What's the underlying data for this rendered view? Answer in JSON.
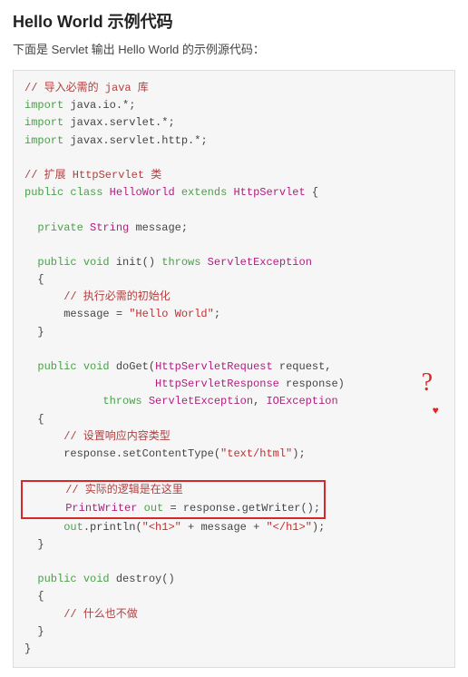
{
  "header": {
    "title": "Hello World 示例代码",
    "subtitle": "下面是 Servlet 输出 Hello World 的示例源代码："
  },
  "code": {
    "c1": "// 导入必需的 java 库",
    "l2a": "import",
    "l2b": " java.io.*;",
    "l3a": "import",
    "l3b": " javax.servlet.*;",
    "l4a": "import",
    "l4b": " javax.servlet.http.*;",
    "c5": "// 扩展 HttpServlet 类",
    "l6a": "public",
    "l6b": " ",
    "l6c": "class",
    "l6d": " ",
    "l6e": "HelloWorld",
    "l6f": " ",
    "l6g": "extends",
    "l6h": " ",
    "l6i": "HttpServlet",
    "l6j": " {",
    "l8a": "  ",
    "l8b": "private",
    "l8c": " ",
    "l8d": "String",
    "l8e": " message;",
    "l10a": "  ",
    "l10b": "public",
    "l10c": " ",
    "l10d": "void",
    "l10e": " init() ",
    "l10f": "throws",
    "l10g": " ",
    "l10h": "ServletException",
    "l11": "  {",
    "c12": "      // 执行必需的初始化",
    "l13a": "      message = ",
    "l13b": "\"Hello World\"",
    "l13c": ";",
    "l14": "  }",
    "l16a": "  ",
    "l16b": "public",
    "l16c": " ",
    "l16d": "void",
    "l16e": " doGet(",
    "l16f": "HttpServletRequest",
    "l16g": " request,",
    "l17a": "                    ",
    "l17b": "HttpServletResponse",
    "l17c": " response)",
    "l18a": "            ",
    "l18b": "throws",
    "l18c": " ",
    "l18d": "ServletException",
    "l18e": ", ",
    "l18f": "IOException",
    "l19": "  {",
    "c20": "      // 设置响应内容类型",
    "l21a": "      response.setContentType(",
    "l21b": "\"text/html\"",
    "l21c": ");",
    "c23": "      // 实际的逻辑是在这里",
    "l24a": "      ",
    "l24b": "PrintWriter",
    "l24c": " ",
    "l24d": "out",
    "l24e": " = response.getWriter();",
    "l25a": "      ",
    "l25b": "out",
    "l25c": ".println(",
    "l25d": "\"<h1>\"",
    "l25e": " + message + ",
    "l25f": "\"</h1>\"",
    "l25g": ");",
    "l26": "  }",
    "l28a": "  ",
    "l28b": "public",
    "l28c": " ",
    "l28d": "void",
    "l28e": " destroy()",
    "l29": "  {",
    "c30": "      // 什么也不做",
    "l31": "  }",
    "l32": "}"
  },
  "annotation": {
    "mark": "?",
    "heart": "♥"
  }
}
